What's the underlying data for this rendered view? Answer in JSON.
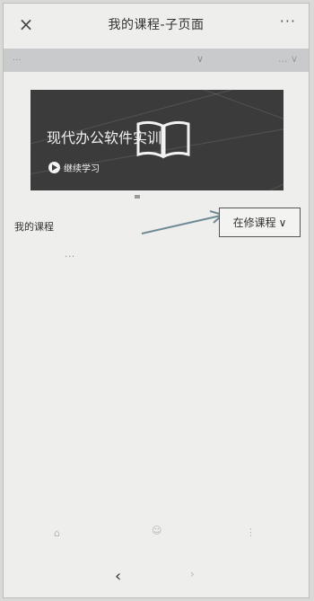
{
  "navbar": {
    "close_icon": "×",
    "title": "我的课程-子页面",
    "more_icon": "···"
  },
  "filter": {
    "left_text": "...",
    "chevron": "∨",
    "right_text": "...",
    "right_chevron": "∨"
  },
  "banner": {
    "title": "现代办公软件实训",
    "continue_label": "继续学习"
  },
  "courses": {
    "section_label": "我的课程",
    "select_label": "在修课程",
    "select_chevron": "∨",
    "empty_text": "..."
  },
  "bottom_nav": {
    "back_icon": "‹",
    "forward_icon": "›"
  }
}
